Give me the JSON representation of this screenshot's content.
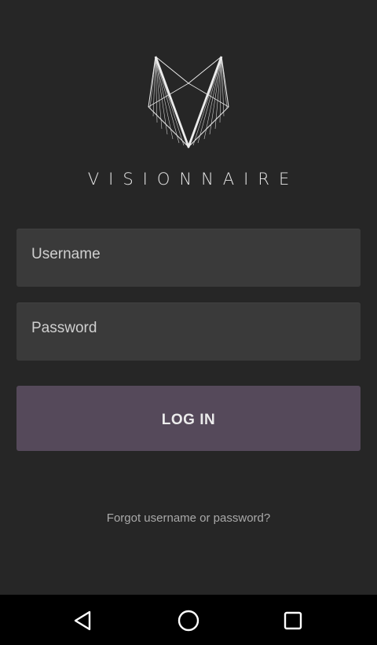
{
  "brand": {
    "name": "VISIONNAIRE",
    "logo_icon": "visionnaire-v-logo-icon"
  },
  "login_form": {
    "username_placeholder": "Username",
    "password_placeholder": "Password",
    "login_label": "LOG IN",
    "forgot_label": "Forgot username or password?"
  },
  "nav_bar": {
    "back_icon": "back-triangle-icon",
    "home_icon": "home-circle-icon",
    "recent_icon": "recent-apps-square-icon"
  },
  "colors": {
    "background": "#262626",
    "field": "#3a3a3a",
    "accent": "#55495a",
    "nav_bar": "#000000"
  }
}
